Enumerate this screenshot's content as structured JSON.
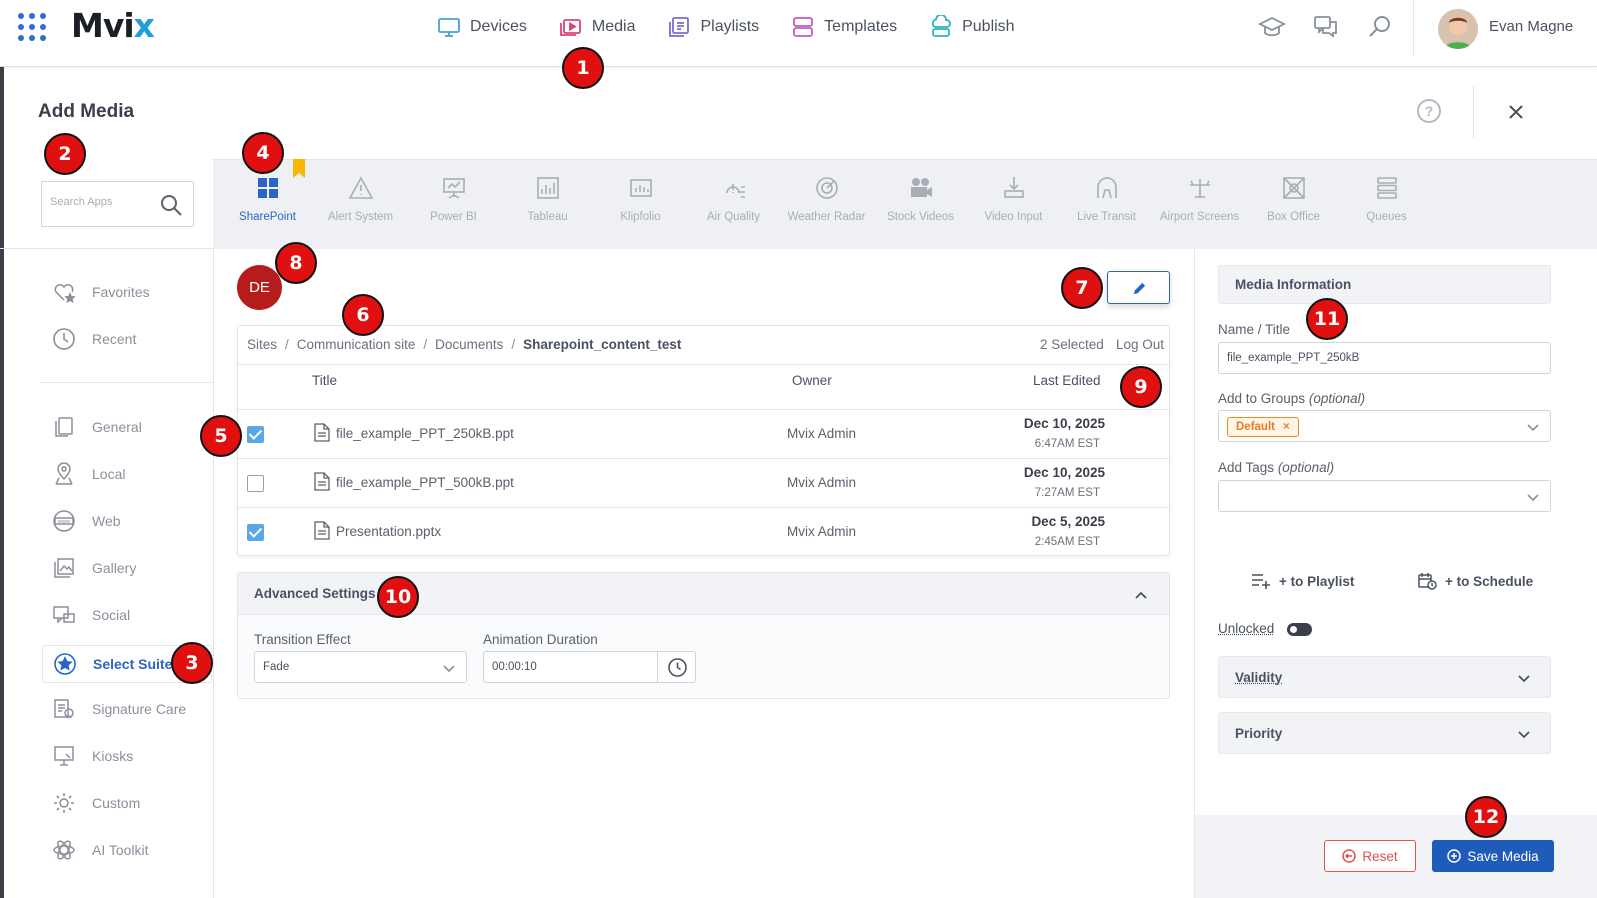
{
  "nav": {
    "logo_main": "Mv",
    "logo_i": "i",
    "logo_x": "x",
    "items": [
      {
        "label": "Devices",
        "icon": "monitor-icon",
        "color": "#4a9fd8"
      },
      {
        "label": "Media",
        "icon": "media-play-icon",
        "color": "#e0407a"
      },
      {
        "label": "Playlists",
        "icon": "playlists-icon",
        "color": "#7a6bd8"
      },
      {
        "label": "Templates",
        "icon": "templates-icon",
        "color": "#c25bc2"
      },
      {
        "label": "Publish",
        "icon": "publish-cloud-icon",
        "color": "#2bb4c6"
      }
    ],
    "user_name": "Evan Magne"
  },
  "modal": {
    "title": "Add Media",
    "help": "?"
  },
  "search": {
    "placeholder": "Search Apps"
  },
  "apps": [
    {
      "label": "SharePoint",
      "icon": "sharepoint-icon",
      "active": true
    },
    {
      "label": "Alert System",
      "icon": "alert-icon",
      "active": false
    },
    {
      "label": "Power BI",
      "icon": "powerbi-icon",
      "active": false
    },
    {
      "label": "Tableau",
      "icon": "tableau-icon",
      "active": false
    },
    {
      "label": "Klipfolio",
      "icon": "klipfolio-icon",
      "active": false
    },
    {
      "label": "Air Quality",
      "icon": "air-quality-icon",
      "active": false
    },
    {
      "label": "Weather Radar",
      "icon": "radar-icon",
      "active": false
    },
    {
      "label": "Stock Videos",
      "icon": "video-camera-icon",
      "active": false
    },
    {
      "label": "Video Input",
      "icon": "video-input-icon",
      "active": false
    },
    {
      "label": "Live Transit",
      "icon": "transit-icon",
      "active": false
    },
    {
      "label": "Airport Screens",
      "icon": "airport-icon",
      "active": false
    },
    {
      "label": "Box Office",
      "icon": "box-office-icon",
      "active": false
    },
    {
      "label": "Queues",
      "icon": "queues-icon",
      "active": false
    }
  ],
  "sidebar": {
    "items": [
      {
        "label": "Favorites",
        "icon": "heart-star-icon"
      },
      {
        "label": "Recent",
        "icon": "clock-icon"
      },
      {
        "label": "General",
        "icon": "files-icon"
      },
      {
        "label": "Local",
        "icon": "map-pin-icon"
      },
      {
        "label": "Web",
        "icon": "web-icon"
      },
      {
        "label": "Gallery",
        "icon": "gallery-icon"
      },
      {
        "label": "Social",
        "icon": "social-icon"
      },
      {
        "label": "Select Suite",
        "icon": "star-circle-icon",
        "active": true
      },
      {
        "label": "Signature Care",
        "icon": "signature-icon"
      },
      {
        "label": "Kiosks",
        "icon": "kiosk-icon"
      },
      {
        "label": "Custom",
        "icon": "gear-icon"
      },
      {
        "label": "AI Toolkit",
        "icon": "ai-icon"
      }
    ]
  },
  "account": {
    "initials": "DE"
  },
  "browser": {
    "breadcrumb": [
      "Sites",
      "Communication site",
      "Documents",
      "Sharepoint_content_test"
    ],
    "breadcrumb_sep": "/",
    "selected_count": "2 Selected",
    "logout": "Log Out",
    "columns": {
      "title": "Title",
      "owner": "Owner",
      "last_edited": "Last Edited"
    },
    "files": [
      {
        "name": "file_example_PPT_250kB.ppt",
        "owner": "Mvix Admin",
        "date": "Dec 10, 2025",
        "time": "6:47AM EST",
        "checked": true
      },
      {
        "name": "file_example_PPT_500kB.ppt",
        "owner": "Mvix Admin",
        "date": "Dec 10, 2025",
        "time": "7:27AM EST",
        "checked": false
      },
      {
        "name": "Presentation.pptx",
        "owner": "Mvix Admin",
        "date": "Dec 5, 2025",
        "time": "2:45AM EST",
        "checked": true
      }
    ]
  },
  "advanced": {
    "title": "Advanced Settings",
    "transition_label": "Transition Effect",
    "transition_value": "Fade",
    "duration_label": "Animation Duration",
    "duration_value": "00:00:10"
  },
  "info": {
    "title": "Media Information",
    "name_label": "Name / Title",
    "name_value": "file_example_PPT_250kB",
    "groups_label": "Add to Groups",
    "optional": "(optional)",
    "group_chip": "Default",
    "chip_remove": "×",
    "tags_label": "Add Tags",
    "to_playlist": "+ to Playlist",
    "to_schedule": "+ to Schedule",
    "unlocked": "Unlocked",
    "validity": "Validity",
    "priority": "Priority",
    "reset": "Reset",
    "save": "Save Media"
  },
  "markers": [
    "1",
    "2",
    "3",
    "4",
    "5",
    "6",
    "7",
    "8",
    "9",
    "10",
    "11",
    "12"
  ],
  "colors": {
    "accent": "#2a64c4",
    "marker": "#e01010",
    "avatar": "#b71c1c",
    "chip": "#f08a24",
    "danger": "#e05252",
    "save": "#1f5bb8"
  }
}
